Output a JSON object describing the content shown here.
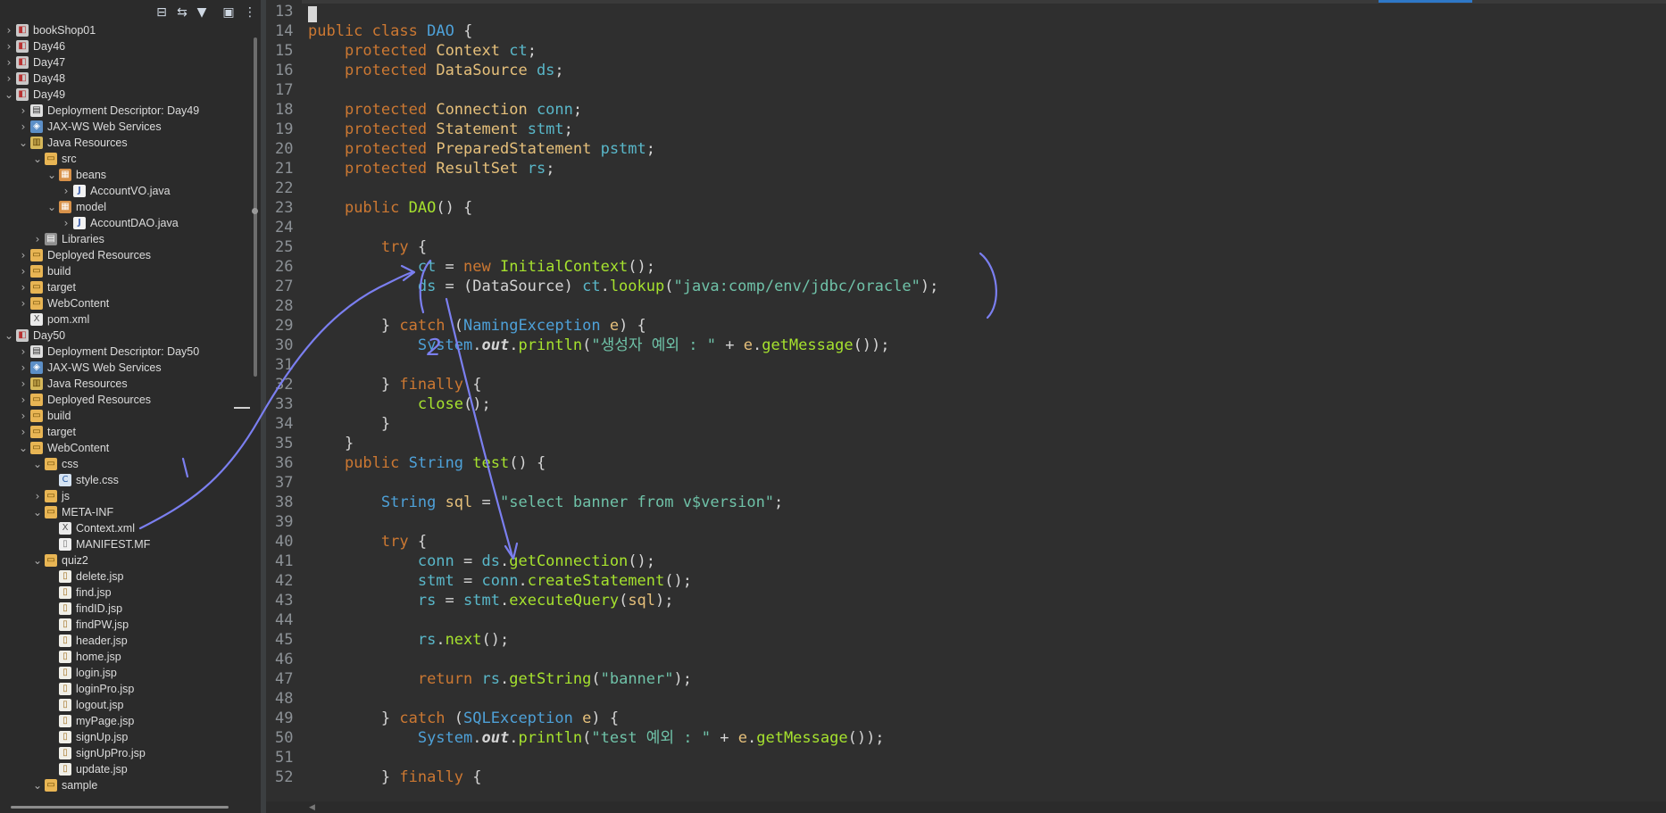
{
  "explorer": {
    "toolbar": [
      {
        "name": "collapse-all-icon",
        "glyph": "⊟"
      },
      {
        "name": "link-with-editor-icon",
        "glyph": "⇆"
      },
      {
        "name": "filter-icon",
        "glyph": "▼"
      },
      {
        "name": "focus-icon",
        "glyph": "▣"
      },
      {
        "name": "view-menu-icon",
        "glyph": "⋮"
      }
    ],
    "tree": [
      {
        "depth": 0,
        "chev": "›",
        "icon": "project",
        "label": "bookShop01"
      },
      {
        "depth": 0,
        "chev": "›",
        "icon": "project",
        "label": "Day46"
      },
      {
        "depth": 0,
        "chev": "›",
        "icon": "project",
        "label": "Day47"
      },
      {
        "depth": 0,
        "chev": "›",
        "icon": "project",
        "label": "Day48"
      },
      {
        "depth": 0,
        "chev": "⌄",
        "icon": "project",
        "label": "Day49"
      },
      {
        "depth": 1,
        "chev": "›",
        "icon": "dd",
        "label": "Deployment Descriptor: Day49"
      },
      {
        "depth": 1,
        "chev": "›",
        "icon": "ws",
        "label": "JAX-WS Web Services"
      },
      {
        "depth": 1,
        "chev": "⌄",
        "icon": "jres",
        "label": "Java Resources"
      },
      {
        "depth": 2,
        "chev": "⌄",
        "icon": "src",
        "label": "src"
      },
      {
        "depth": 3,
        "chev": "⌄",
        "icon": "pkg",
        "label": "beans"
      },
      {
        "depth": 4,
        "chev": "›",
        "icon": "java",
        "label": "AccountVO.java"
      },
      {
        "depth": 3,
        "chev": "⌄",
        "icon": "pkg",
        "label": "model"
      },
      {
        "depth": 4,
        "chev": "›",
        "icon": "java",
        "label": "AccountDAO.java"
      },
      {
        "depth": 2,
        "chev": "›",
        "icon": "lib",
        "label": "Libraries"
      },
      {
        "depth": 1,
        "chev": "›",
        "icon": "folder",
        "label": "Deployed Resources"
      },
      {
        "depth": 1,
        "chev": "›",
        "icon": "folder",
        "label": "build"
      },
      {
        "depth": 1,
        "chev": "›",
        "icon": "folder",
        "label": "target"
      },
      {
        "depth": 1,
        "chev": "›",
        "icon": "folder",
        "label": "WebContent"
      },
      {
        "depth": 1,
        "chev": "",
        "icon": "xml",
        "label": "pom.xml"
      },
      {
        "depth": 0,
        "chev": "⌄",
        "icon": "project",
        "label": "Day50"
      },
      {
        "depth": 1,
        "chev": "›",
        "icon": "dd",
        "label": "Deployment Descriptor: Day50"
      },
      {
        "depth": 1,
        "chev": "›",
        "icon": "ws",
        "label": "JAX-WS Web Services"
      },
      {
        "depth": 1,
        "chev": "›",
        "icon": "jres",
        "label": "Java Resources"
      },
      {
        "depth": 1,
        "chev": "›",
        "icon": "folder",
        "label": "Deployed Resources"
      },
      {
        "depth": 1,
        "chev": "›",
        "icon": "folder",
        "label": "build"
      },
      {
        "depth": 1,
        "chev": "›",
        "icon": "folder",
        "label": "target"
      },
      {
        "depth": 1,
        "chev": "⌄",
        "icon": "folder",
        "label": "WebContent"
      },
      {
        "depth": 2,
        "chev": "⌄",
        "icon": "folder",
        "label": "css"
      },
      {
        "depth": 3,
        "chev": "",
        "icon": "css",
        "label": "style.css"
      },
      {
        "depth": 2,
        "chev": "›",
        "icon": "folder",
        "label": "js"
      },
      {
        "depth": 2,
        "chev": "⌄",
        "icon": "folder",
        "label": "META-INF"
      },
      {
        "depth": 3,
        "chev": "",
        "icon": "xml",
        "label": "Context.xml"
      },
      {
        "depth": 3,
        "chev": "",
        "icon": "file",
        "label": "MANIFEST.MF"
      },
      {
        "depth": 2,
        "chev": "⌄",
        "icon": "folder",
        "label": "quiz2"
      },
      {
        "depth": 3,
        "chev": "",
        "icon": "jsp",
        "label": "delete.jsp"
      },
      {
        "depth": 3,
        "chev": "",
        "icon": "jsp",
        "label": "find.jsp"
      },
      {
        "depth": 3,
        "chev": "",
        "icon": "jsp",
        "label": "findID.jsp"
      },
      {
        "depth": 3,
        "chev": "",
        "icon": "jsp",
        "label": "findPW.jsp"
      },
      {
        "depth": 3,
        "chev": "",
        "icon": "jsp",
        "label": "header.jsp"
      },
      {
        "depth": 3,
        "chev": "",
        "icon": "jsp",
        "label": "home.jsp"
      },
      {
        "depth": 3,
        "chev": "",
        "icon": "jsp",
        "label": "login.jsp"
      },
      {
        "depth": 3,
        "chev": "",
        "icon": "jsp",
        "label": "loginPro.jsp"
      },
      {
        "depth": 3,
        "chev": "",
        "icon": "jsp",
        "label": "logout.jsp"
      },
      {
        "depth": 3,
        "chev": "",
        "icon": "jsp",
        "label": "myPage.jsp"
      },
      {
        "depth": 3,
        "chev": "",
        "icon": "jsp",
        "label": "signUp.jsp"
      },
      {
        "depth": 3,
        "chev": "",
        "icon": "jsp",
        "label": "signUpPro.jsp"
      },
      {
        "depth": 3,
        "chev": "",
        "icon": "jsp",
        "label": "update.jsp"
      },
      {
        "depth": 2,
        "chev": "⌄",
        "icon": "folder",
        "label": "sample"
      }
    ]
  },
  "editor": {
    "lines": [
      {
        "n": "13",
        "tokens": []
      },
      {
        "n": "14",
        "tokens": [
          [
            "kw",
            "public"
          ],
          [
            "",
            "&nbsp;"
          ],
          [
            "kw",
            "class"
          ],
          [
            "",
            "&nbsp;"
          ],
          [
            "ty",
            "DAO"
          ],
          [
            "",
            "&nbsp;{"
          ]
        ]
      },
      {
        "n": "15",
        "tokens": [
          [
            "",
            "    "
          ],
          [
            "kw",
            "protected"
          ],
          [
            "",
            "&nbsp;"
          ],
          [
            "var",
            "Context"
          ],
          [
            "",
            "&nbsp;"
          ],
          [
            "ct",
            "ct"
          ],
          [
            "",
            ";"
          ]
        ]
      },
      {
        "n": "16",
        "tokens": [
          [
            "",
            "    "
          ],
          [
            "kw",
            "protected"
          ],
          [
            "",
            "&nbsp;"
          ],
          [
            "var",
            "DataSource"
          ],
          [
            "",
            "&nbsp;"
          ],
          [
            "ct",
            "ds"
          ],
          [
            "",
            ";"
          ]
        ]
      },
      {
        "n": "17",
        "tokens": []
      },
      {
        "n": "18",
        "tokens": [
          [
            "",
            "    "
          ],
          [
            "kw",
            "protected"
          ],
          [
            "",
            "&nbsp;"
          ],
          [
            "var",
            "Connection"
          ],
          [
            "",
            "&nbsp;"
          ],
          [
            "ct",
            "conn"
          ],
          [
            "",
            ";"
          ]
        ]
      },
      {
        "n": "19",
        "tokens": [
          [
            "",
            "    "
          ],
          [
            "kw",
            "protected"
          ],
          [
            "",
            "&nbsp;"
          ],
          [
            "var",
            "Statement"
          ],
          [
            "",
            "&nbsp;"
          ],
          [
            "ct",
            "stmt"
          ],
          [
            "",
            ";"
          ]
        ]
      },
      {
        "n": "20",
        "tokens": [
          [
            "",
            "    "
          ],
          [
            "kw",
            "protected"
          ],
          [
            "",
            "&nbsp;"
          ],
          [
            "var",
            "PreparedStatement"
          ],
          [
            "",
            "&nbsp;"
          ],
          [
            "ct",
            "pstmt"
          ],
          [
            "",
            ";"
          ]
        ]
      },
      {
        "n": "21",
        "tokens": [
          [
            "",
            "    "
          ],
          [
            "kw",
            "protected"
          ],
          [
            "",
            "&nbsp;"
          ],
          [
            "var",
            "ResultSet"
          ],
          [
            "",
            "&nbsp;"
          ],
          [
            "ct",
            "rs"
          ],
          [
            "",
            ";"
          ]
        ]
      },
      {
        "n": "22",
        "tokens": []
      },
      {
        "n": "23",
        "tokens": [
          [
            "",
            "    "
          ],
          [
            "kw",
            "public"
          ],
          [
            "",
            "&nbsp;"
          ],
          [
            "fn",
            "DAO"
          ],
          [
            "",
            "() {"
          ]
        ]
      },
      {
        "n": "24",
        "tokens": []
      },
      {
        "n": "25",
        "tokens": [
          [
            "",
            "        "
          ],
          [
            "kw",
            "try"
          ],
          [
            "",
            "&nbsp;{"
          ]
        ]
      },
      {
        "n": "26",
        "tokens": [
          [
            "",
            "            "
          ],
          [
            "ct",
            "ct"
          ],
          [
            "",
            "&nbsp;=&nbsp;"
          ],
          [
            "kw",
            "new"
          ],
          [
            "",
            "&nbsp;"
          ],
          [
            "fn",
            "InitialContext"
          ],
          [
            "",
            "();"
          ]
        ]
      },
      {
        "n": "27",
        "tokens": [
          [
            "",
            "            "
          ],
          [
            "ct",
            "ds"
          ],
          [
            "",
            "&nbsp;= (DataSource)&nbsp;"
          ],
          [
            "ct",
            "ct"
          ],
          [
            "",
            "."
          ],
          [
            "fn",
            "lookup"
          ],
          [
            "",
            "("
          ],
          [
            "st",
            "\"java:comp/env/jdbc/oracle\""
          ],
          [
            "",
            ");"
          ]
        ]
      },
      {
        "n": "28",
        "tokens": []
      },
      {
        "n": "29",
        "tokens": [
          [
            "",
            "        } "
          ],
          [
            "kw",
            "catch"
          ],
          [
            "",
            "&nbsp;("
          ],
          [
            "ty",
            "NamingException"
          ],
          [
            "",
            "&nbsp;"
          ],
          [
            "var",
            "e"
          ],
          [
            "",
            ") {"
          ]
        ]
      },
      {
        "n": "30",
        "tokens": [
          [
            "",
            "            "
          ],
          [
            "sys",
            "System"
          ],
          [
            "",
            "."
          ],
          [
            "out",
            "out"
          ],
          [
            "",
            "."
          ],
          [
            "fn",
            "println"
          ],
          [
            "",
            "("
          ],
          [
            "st",
            "\"생성자 예외 : \""
          ],
          [
            "",
            "&nbsp;+&nbsp;"
          ],
          [
            "var",
            "e"
          ],
          [
            "",
            "."
          ],
          [
            "fn",
            "getMessage"
          ],
          [
            "",
            "());"
          ]
        ]
      },
      {
        "n": "31",
        "tokens": []
      },
      {
        "n": "32",
        "tokens": [
          [
            "",
            "        } "
          ],
          [
            "kw",
            "finally"
          ],
          [
            "",
            "&nbsp;{"
          ]
        ]
      },
      {
        "n": "33",
        "tokens": [
          [
            "",
            "            "
          ],
          [
            "fn",
            "close"
          ],
          [
            "",
            "();"
          ]
        ]
      },
      {
        "n": "34",
        "tokens": [
          [
            "",
            "        }"
          ]
        ]
      },
      {
        "n": "35",
        "tokens": [
          [
            "",
            "    }"
          ]
        ]
      },
      {
        "n": "36",
        "tokens": [
          [
            "",
            "    "
          ],
          [
            "kw",
            "public"
          ],
          [
            "",
            "&nbsp;"
          ],
          [
            "ty",
            "String"
          ],
          [
            "",
            "&nbsp;"
          ],
          [
            "fn",
            "test"
          ],
          [
            "",
            "() {"
          ]
        ]
      },
      {
        "n": "37",
        "tokens": []
      },
      {
        "n": "38",
        "tokens": [
          [
            "",
            "        "
          ],
          [
            "ty",
            "String"
          ],
          [
            "",
            "&nbsp;"
          ],
          [
            "var",
            "sql"
          ],
          [
            "",
            "&nbsp;=&nbsp;"
          ],
          [
            "st",
            "\"select banner from v$version\""
          ],
          [
            "",
            ";"
          ]
        ]
      },
      {
        "n": "39",
        "tokens": []
      },
      {
        "n": "40",
        "tokens": [
          [
            "",
            "        "
          ],
          [
            "kw",
            "try"
          ],
          [
            "",
            "&nbsp;{"
          ]
        ]
      },
      {
        "n": "41",
        "tokens": [
          [
            "",
            "            "
          ],
          [
            "ct",
            "conn"
          ],
          [
            "",
            "&nbsp;=&nbsp;"
          ],
          [
            "ct",
            "ds"
          ],
          [
            "",
            "."
          ],
          [
            "fn",
            "getConnection"
          ],
          [
            "",
            "();"
          ]
        ]
      },
      {
        "n": "42",
        "tokens": [
          [
            "",
            "            "
          ],
          [
            "ct",
            "stmt"
          ],
          [
            "",
            "&nbsp;=&nbsp;"
          ],
          [
            "ct",
            "conn"
          ],
          [
            "",
            "."
          ],
          [
            "fn",
            "createStatement"
          ],
          [
            "",
            "();"
          ]
        ]
      },
      {
        "n": "43",
        "tokens": [
          [
            "",
            "            "
          ],
          [
            "ct",
            "rs"
          ],
          [
            "",
            "&nbsp;=&nbsp;"
          ],
          [
            "ct",
            "stmt"
          ],
          [
            "",
            "."
          ],
          [
            "fn",
            "executeQuery"
          ],
          [
            "",
            "("
          ],
          [
            "var",
            "sql"
          ],
          [
            "",
            ");"
          ]
        ]
      },
      {
        "n": "44",
        "tokens": []
      },
      {
        "n": "45",
        "tokens": [
          [
            "",
            "            "
          ],
          [
            "ct",
            "rs"
          ],
          [
            "",
            "."
          ],
          [
            "fn",
            "next"
          ],
          [
            "",
            "();"
          ]
        ]
      },
      {
        "n": "46",
        "tokens": []
      },
      {
        "n": "47",
        "tokens": [
          [
            "",
            "            "
          ],
          [
            "kw",
            "return"
          ],
          [
            "",
            "&nbsp;"
          ],
          [
            "ct",
            "rs"
          ],
          [
            "",
            "."
          ],
          [
            "fn",
            "getString"
          ],
          [
            "",
            "("
          ],
          [
            "st",
            "\"banner\""
          ],
          [
            "",
            ");"
          ]
        ]
      },
      {
        "n": "48",
        "tokens": []
      },
      {
        "n": "49",
        "tokens": [
          [
            "",
            "        } "
          ],
          [
            "kw",
            "catch"
          ],
          [
            "",
            "&nbsp;("
          ],
          [
            "ty",
            "SQLException"
          ],
          [
            "",
            "&nbsp;"
          ],
          [
            "var",
            "e"
          ],
          [
            "",
            ") {"
          ]
        ]
      },
      {
        "n": "50",
        "tokens": [
          [
            "",
            "            "
          ],
          [
            "sys",
            "System"
          ],
          [
            "",
            "."
          ],
          [
            "out",
            "out"
          ],
          [
            "",
            "."
          ],
          [
            "fn",
            "println"
          ],
          [
            "",
            "("
          ],
          [
            "st",
            "\"test 예외 : \""
          ],
          [
            "",
            "&nbsp;+&nbsp;"
          ],
          [
            "var",
            "e"
          ],
          [
            "",
            "."
          ],
          [
            "fn",
            "getMessage"
          ],
          [
            "",
            "());"
          ]
        ]
      },
      {
        "n": "51",
        "tokens": []
      },
      {
        "n": "52",
        "tokens": [
          [
            "",
            "        } "
          ],
          [
            "kw",
            "finally"
          ],
          [
            "",
            "&nbsp;{"
          ]
        ]
      }
    ]
  },
  "annotation": {
    "color": "#7b7ff0",
    "digit": "2"
  }
}
